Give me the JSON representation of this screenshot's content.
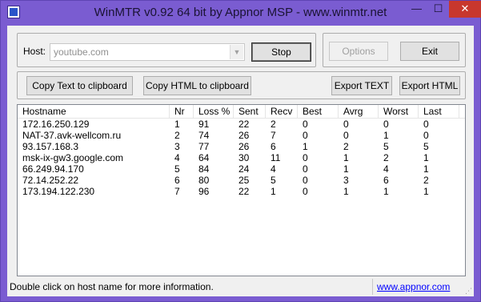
{
  "window": {
    "title": "WinMTR v0.92 64 bit by Appnor MSP - www.winmtr.net",
    "minimize_glyph": "—",
    "maximize_glyph": "☐",
    "close_glyph": "✕"
  },
  "host_group": {
    "label": "Host:",
    "input_value": "youtube.com",
    "stop_label": "Stop"
  },
  "options_label": "Options",
  "exit_label": "Exit",
  "export": {
    "copy_text": "Copy Text to clipboard",
    "copy_html": "Copy HTML to clipboard",
    "export_text": "Export TEXT",
    "export_html": "Export HTML"
  },
  "table": {
    "headers": [
      "Hostname",
      "Nr",
      "Loss %",
      "Sent",
      "Recv",
      "Best",
      "Avrg",
      "Worst",
      "Last"
    ],
    "rows": [
      [
        "172.16.250.129",
        "1",
        "91",
        "22",
        "2",
        "0",
        "0",
        "0",
        "0"
      ],
      [
        "NAT-37.avk-wellcom.ru",
        "2",
        "74",
        "26",
        "7",
        "0",
        "0",
        "1",
        "0"
      ],
      [
        "93.157.168.3",
        "3",
        "77",
        "26",
        "6",
        "1",
        "2",
        "5",
        "5"
      ],
      [
        "msk-ix-gw3.google.com",
        "4",
        "64",
        "30",
        "11",
        "0",
        "1",
        "2",
        "1"
      ],
      [
        "66.249.94.170",
        "5",
        "84",
        "24",
        "4",
        "0",
        "1",
        "4",
        "1"
      ],
      [
        "72.14.252.22",
        "6",
        "80",
        "25",
        "5",
        "0",
        "3",
        "6",
        "2"
      ],
      [
        "173.194.122.230",
        "7",
        "96",
        "22",
        "1",
        "0",
        "1",
        "1",
        "1"
      ]
    ]
  },
  "status": {
    "message": "Double click on host name for more information.",
    "link": "www.appnor.com"
  }
}
